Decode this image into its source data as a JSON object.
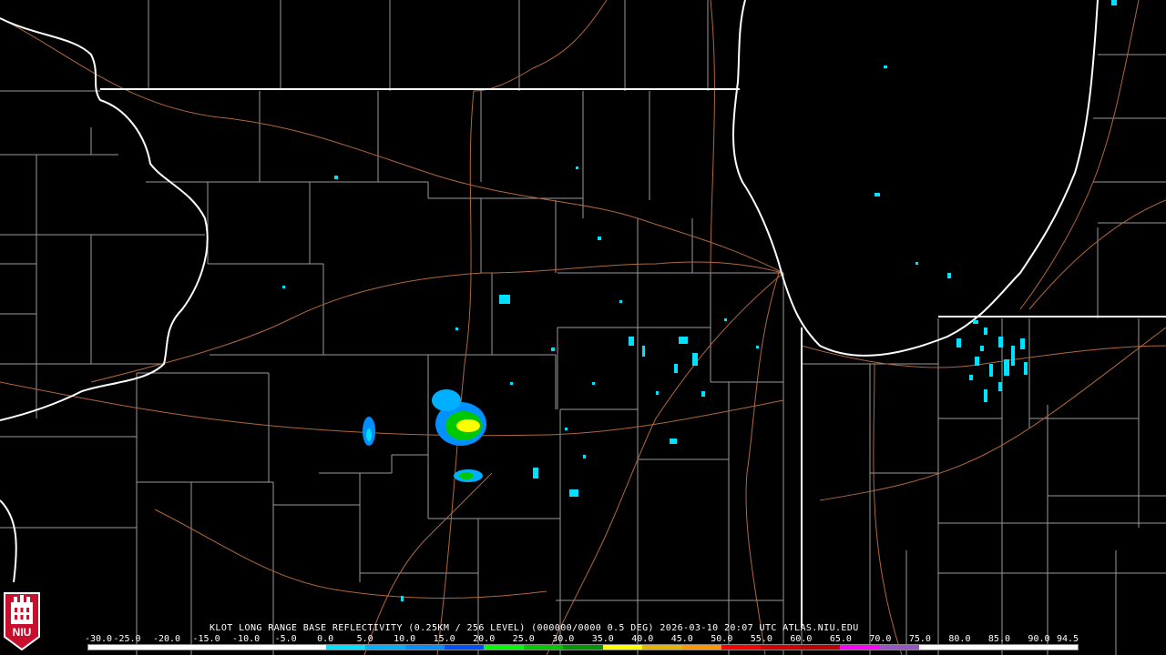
{
  "product": {
    "caption": "KLOT LONG RANGE BASE REFLECTIVITY (0.25KM / 256 LEVEL) (000000/0000 0.5 DEG) 2026-03-10 20:07 UTC  ATLAS.NIU.EDU"
  },
  "logo": {
    "text": "NIU",
    "icon": "niu-tower-logo-icon",
    "color": "#c8102e"
  },
  "legend": {
    "labels": [
      "-30.0",
      "-25.0",
      "-20.0",
      "-15.0",
      "-10.0",
      "-5.0",
      "0.0",
      "5.0",
      "10.0",
      "15.0",
      "20.0",
      "25.0",
      "30.0",
      "35.0",
      "40.0",
      "45.0",
      "50.0",
      "55.0",
      "60.0",
      "65.0",
      "70.0",
      "75.0",
      "80.0",
      "85.0",
      "90.0",
      "94.5"
    ],
    "colors": [
      "#ffffff",
      "#ffffff",
      "#ffffff",
      "#ffffff",
      "#ffffff",
      "#ffffff",
      "#00e0ff",
      "#00b0ff",
      "#0090ff",
      "#0050ff",
      "#00ff00",
      "#00c800",
      "#009600",
      "#ffff00",
      "#e6b400",
      "#ff9600",
      "#ff0000",
      "#d40000",
      "#bc0000",
      "#ff00ff",
      "#9955c8",
      "#ffffff",
      "#ffffff",
      "#ffffff",
      "#ffffff"
    ]
  },
  "colors": {
    "background": "#000000",
    "county_lines": "#9a9a9a",
    "state_lines": "#ffffff",
    "highways": "#b0683c",
    "echo_light": "#00e0ff",
    "echo_mid": "#0090ff",
    "echo_green": "#00c800",
    "echo_yellow": "#ffff00"
  }
}
